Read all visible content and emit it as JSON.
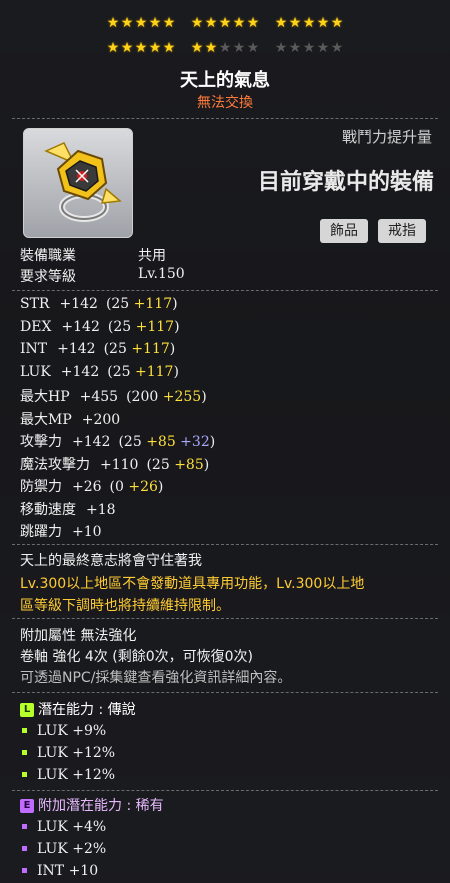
{
  "stars": {
    "row1": [
      1,
      1,
      1,
      1,
      1,
      1,
      1,
      1,
      1,
      1,
      1,
      1,
      1,
      1,
      1
    ],
    "row2": [
      1,
      1,
      1,
      1,
      1,
      1,
      1,
      0,
      0,
      0,
      0,
      0,
      0,
      0,
      0
    ]
  },
  "item": {
    "name": "天上的氣息",
    "trade": "無法交換",
    "power_label": "戰鬥力提升量",
    "equipped_text": "目前穿戴中的裝備",
    "tags": [
      "飾品",
      "戒指"
    ]
  },
  "requirements": {
    "job_label": "裝備職業",
    "job_value": "共用",
    "level_label": "要求等級",
    "level_value": "Lv.150"
  },
  "stats": [
    {
      "label": "STR",
      "value": "+142",
      "base": "(25 ",
      "bonus": "+117",
      "extra": "",
      "close": ")"
    },
    {
      "label": "DEX",
      "value": "+142",
      "base": "(25 ",
      "bonus": "+117",
      "extra": "",
      "close": ")"
    },
    {
      "label": "INT",
      "value": "+142",
      "base": "(25 ",
      "bonus": "+117",
      "extra": "",
      "close": ")"
    },
    {
      "label": "LUK",
      "value": "+142",
      "base": "(25 ",
      "bonus": "+117",
      "extra": "",
      "close": ")"
    },
    {
      "label": "最大HP",
      "value": "+455",
      "base": "(200 ",
      "bonus": "+255",
      "extra": "",
      "close": ")"
    },
    {
      "label": "最大MP",
      "value": "+200",
      "base": "",
      "bonus": "",
      "extra": "",
      "close": ""
    },
    {
      "label": "攻擊力",
      "value": "+142",
      "base": "(25 ",
      "bonus": "+85",
      "extra": " +32",
      "close": ")"
    },
    {
      "label": "魔法攻擊力",
      "value": "+110",
      "base": "(25 ",
      "bonus": "+85",
      "extra": "",
      "close": ")"
    },
    {
      "label": "防禦力",
      "value": "+26",
      "base": "(0 ",
      "bonus": "+26",
      "extra": "",
      "close": ")"
    },
    {
      "label": "移動速度",
      "value": "+18",
      "base": "",
      "bonus": "",
      "extra": "",
      "close": ""
    },
    {
      "label": "跳躍力",
      "value": "+10",
      "base": "",
      "bonus": "",
      "extra": "",
      "close": ""
    }
  ],
  "description": {
    "flavor": "天上的最終意志將會守住著我",
    "notice_line1": "Lv.300以上地區不會發動道具專用功能，Lv.300以上地",
    "notice_line2": "區等級下調時也將持續維持限制。"
  },
  "enhance": {
    "attr": "附加屬性 無法強化",
    "scroll": "卷軸 強化 4次 (剩餘0次，可恢復0次)",
    "hint": "可透過NPC/採集鍵查看強化資訊詳細內容。"
  },
  "potential": {
    "badge": "L",
    "label": "潛在能力 : 傳說",
    "lines": [
      "LUK +9%",
      "LUK +12%",
      "LUK +12%"
    ]
  },
  "additional_potential": {
    "badge": "E",
    "label": "附加潛在能力 : 稀有",
    "lines": [
      "LUK +4%",
      "LUK +2%",
      "INT +10"
    ]
  },
  "colors": {
    "legendary": "#b7ff2b",
    "epic": "#c06dff",
    "notice": "#ffcc33",
    "trade": "#ff7a3a"
  }
}
